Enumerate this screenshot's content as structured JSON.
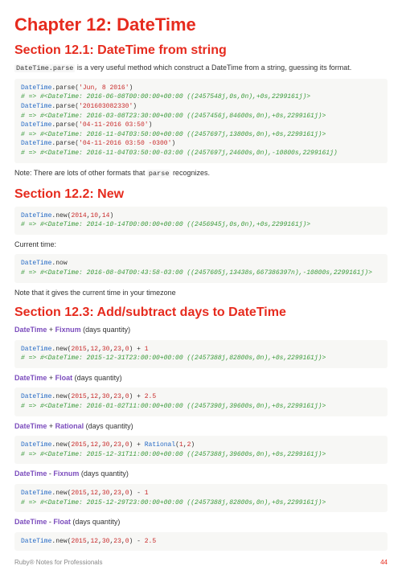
{
  "chapter_title": "Chapter 12: DateTime",
  "s1": {
    "heading": "Section 12.1: DateTime from string",
    "intro_pre": "DateTime.parse",
    "intro_post": " is a very useful method which construct a DateTime from a string, guessing its format.",
    "code": "DateTime.parse('Jun, 8 2016')\n# => #<DateTime: 2016-06-08T00:00:00+00:00 ((2457548j,0s,0n),+0s,2299161j)>\nDateTime.parse('201603082330')\n# => #<DateTime: 2016-03-08T23:30:00+00:00 ((2457456j,84600s,0n),+0s,2299161j)>\nDateTime.parse('04-11-2016 03:50')\n# => #<DateTime: 2016-11-04T03:50:00+00:00 ((2457697j,13800s,0n),+0s,2299161j)>\nDateTime.parse('04-11-2016 03:50 -0300')\n# => #<DateTime: 2016-11-04T03:50:00-03:00 ((2457697j,24600s,0n),-10800s,2299161j)",
    "note_pre": "Note: There are lots of other formats that ",
    "note_code": "parse",
    "note_post": " recognizes."
  },
  "s2": {
    "heading": "Section 12.2: New",
    "code1": "DateTime.new(2014,10,14)\n# => #<DateTime: 2014-10-14T00:00:00+00:00 ((2456945j,0s,0n),+0s,2299161j)>",
    "mid": "Current time:",
    "code2": "DateTime.now\n# => #<DateTime: 2016-08-04T00:43:58-03:00 ((2457605j,13438s,667386397n),-10800s,2299161j)>",
    "note": "Note that it gives the current time in your timezone"
  },
  "s3": {
    "heading": "Section 12.3: Add/subtract days to DateTime",
    "p1_a": "DateTime",
    "p1_op": " + ",
    "p1_b": "Fixnum",
    "p1_t": " (days quantity)",
    "c1": "DateTime.new(2015,12,30,23,0) + 1\n# => #<DateTime: 2015-12-31T23:00:00+00:00 ((2457388j,82800s,0n),+0s,2299161j)>",
    "p2_a": "DateTime",
    "p2_op": " + ",
    "p2_b": "Float",
    "p2_t": " (days quantity)",
    "c2": "DateTime.new(2015,12,30,23,0) + 2.5\n# => #<DateTime: 2016-01-02T11:00:00+00:00 ((2457390j,39600s,0n),+0s,2299161j)>",
    "p3_a": "DateTime",
    "p3_op": " + ",
    "p3_b": "Rational",
    "p3_t": " (days quantity)",
    "c3": "DateTime.new(2015,12,30,23,0) + Rational(1,2)\n# => #<DateTime: 2015-12-31T11:00:00+00:00 ((2457388j,39600s,0n),+0s,2299161j)>",
    "p4_a": "DateTime",
    "p4_op": " - ",
    "p4_b": "Fixnum",
    "p4_t": " (days quantity)",
    "c4": "DateTime.new(2015,12,30,23,0) - 1\n# => #<DateTime: 2015-12-29T23:00:00+00:00 ((2457388j,82800s,0n),+0s,2299161j)>",
    "p5_a": "DateTime",
    "p5_op": " - ",
    "p5_b": "Float",
    "p5_t": " (days quantity)",
    "c5": "DateTime.new(2015,12,30,23,0) - 2.5"
  },
  "footer": {
    "left": "Ruby® Notes for Professionals",
    "right": "44"
  }
}
